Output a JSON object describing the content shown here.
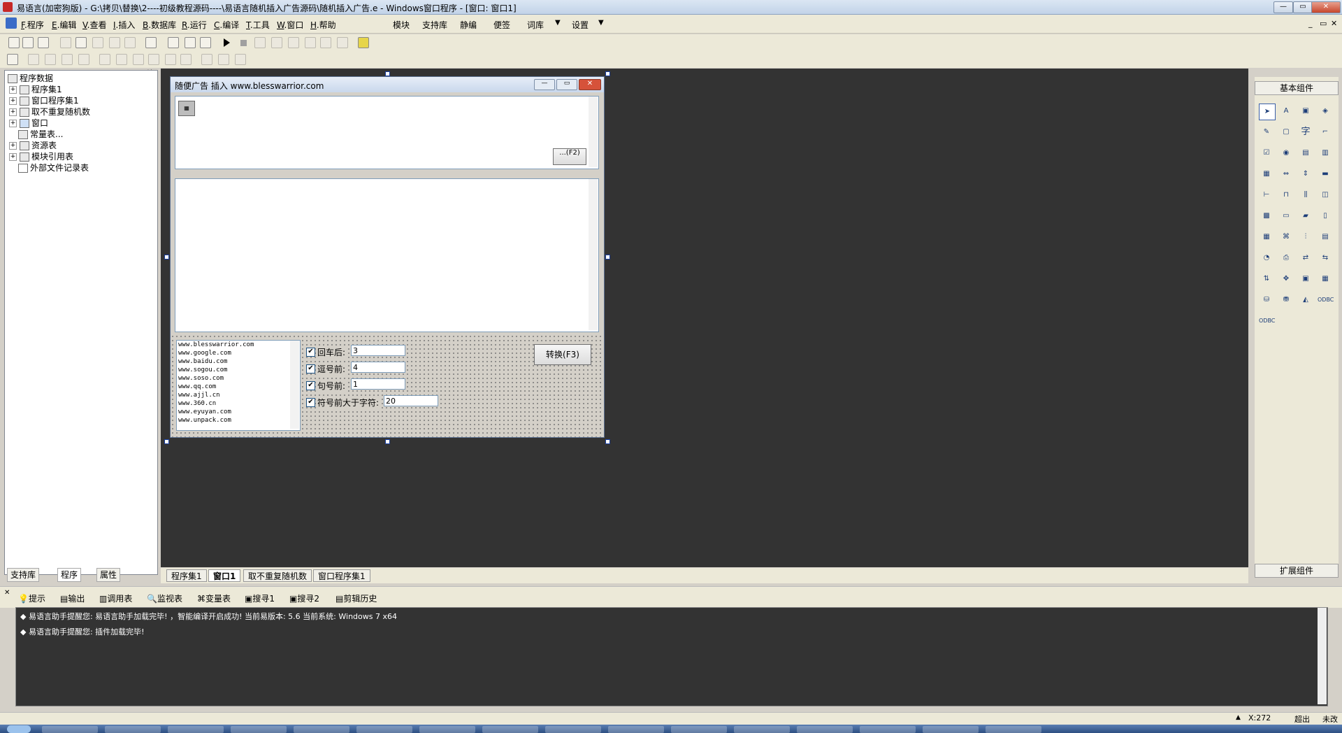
{
  "window": {
    "title": "易语言(加密狗版) - G:\\拷贝\\替换\\2----初级教程源码----\\易语言随机插入广告源码\\随机插入广告.e - Windows窗口程序 - [窗口: 窗口1]",
    "min": "—",
    "max": "▭",
    "close": "✕"
  },
  "menu": {
    "items": [
      {
        "key": "F",
        "label": "程序"
      },
      {
        "key": "E",
        "label": "编辑"
      },
      {
        "key": "V",
        "label": "查看"
      },
      {
        "key": "I",
        "label": "插入"
      },
      {
        "key": "B",
        "label": "数据库"
      },
      {
        "key": "R",
        "label": "运行"
      },
      {
        "key": "C",
        "label": "编译"
      },
      {
        "key": "T",
        "label": "工具"
      },
      {
        "key": "W",
        "label": "窗口"
      },
      {
        "key": "H",
        "label": "帮助"
      }
    ],
    "extra": [
      "模块",
      "支持库",
      "静编",
      "便签",
      "词库",
      "设置"
    ]
  },
  "tree": {
    "root": "程序数据",
    "items": [
      "程序集1",
      "窗口程序集1",
      "取不重复随机数",
      "窗口",
      "常量表...",
      "资源表",
      "模块引用表",
      "外部文件记录表"
    ]
  },
  "left_tabs": [
    "支持库",
    "程序",
    "属性"
  ],
  "form": {
    "title": "随便广告 插入 www.blesswarrior.com",
    "small_button": "...(F2)",
    "list_items": [
      "www.blesswarrior.com",
      "www.google.com",
      "www.baidu.com",
      "www.sogou.com",
      "www.soso.com",
      "www.qq.com",
      "www.ajjl.cn",
      "www.360.cn",
      "www.eyuyan.com",
      "www.unpack.com"
    ],
    "options": [
      {
        "label": "回车后:",
        "value": "3"
      },
      {
        "label": "逗号前:",
        "value": "4"
      },
      {
        "label": "句号前:",
        "value": "1"
      },
      {
        "label": "符号前大于字符:",
        "value": "20"
      }
    ],
    "convert_button": "转换(F3)"
  },
  "editor_tabs": [
    "程序集1",
    "窗口1",
    "取不重复随机数",
    "窗口程序集1"
  ],
  "toolbox": {
    "title": "基本组件",
    "footer": "扩展组件"
  },
  "output_tabs": [
    "提示",
    "输出",
    "调用表",
    "监视表",
    "变量表",
    "搜寻1",
    "搜寻2",
    "剪辑历史"
  ],
  "output_lines": [
    "易语言助手提醒您: 易语言助手加载完毕! ，智能编译开启成功! 当前易版本: 5.6 当前系统: Windows 7 x64",
    "易语言助手提醒您: 插件加载完毕!"
  ],
  "status": {
    "coords": "X:272",
    "overwrite": "超出",
    "modified": "未改"
  }
}
